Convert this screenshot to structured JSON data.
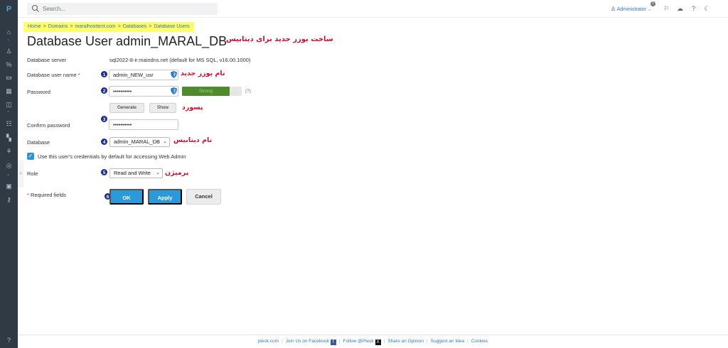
{
  "app": {
    "logo": "P"
  },
  "search": {
    "placeholder": "Search..."
  },
  "header": {
    "user": "Administrator",
    "notifications_count": "1"
  },
  "breadcrumb": [
    "Home",
    "Domains",
    "maralhosttest.com",
    "Databases",
    "Database Users"
  ],
  "page_title": "Database User admin_MARAL_DB",
  "annotations": {
    "title_note": "ساخت یوزر جدید برای دیتابیس",
    "username_note": "نام یوزر جدید",
    "password_note": "پسورد",
    "database_note": "نام دیتابیس",
    "role_note": "پرمیژن"
  },
  "form": {
    "server_label": "Database server",
    "server_value": "sql2022-8-ir.maindns.net (default for MS SQL, v16.00.1000)",
    "username_label": "Database user name",
    "required_mark": "*",
    "username_value": "admin_NEW_usr",
    "password_label": "Password",
    "password_value": "••••••••••",
    "strength_label": "Strong",
    "strength_level": 0.8,
    "help_link": "(?)",
    "generate_label": "Generate",
    "show_label": "Show",
    "confirm_label": "Confirm password",
    "confirm_value": "••••••••••",
    "database_label": "Database",
    "database_value": "admin_MARAL_DB",
    "default_credentials_label": "Use this user's credentials by default for accessing Web Admin",
    "default_credentials_checked": true,
    "role_label": "Role",
    "role_value": "Read and Write",
    "required_note": "Required fields",
    "ok_label": "OK",
    "apply_label": "Apply",
    "cancel_label": "Cancel"
  },
  "steps": [
    "1",
    "2",
    "3",
    "4",
    "5",
    "6"
  ],
  "footer": {
    "links": [
      "plesk.com",
      "Join Us on Facebook",
      "Follow @Plesk",
      "Share an Opinion",
      "Suggest an Idea",
      "Cookies"
    ]
  },
  "colors": {
    "accent": "#2c9ad8",
    "breadcrumb_highlight": "#ffff66",
    "annotation": "#c8102e",
    "step_badge": "#1d2c8f",
    "strength": "#4f8a2f"
  }
}
